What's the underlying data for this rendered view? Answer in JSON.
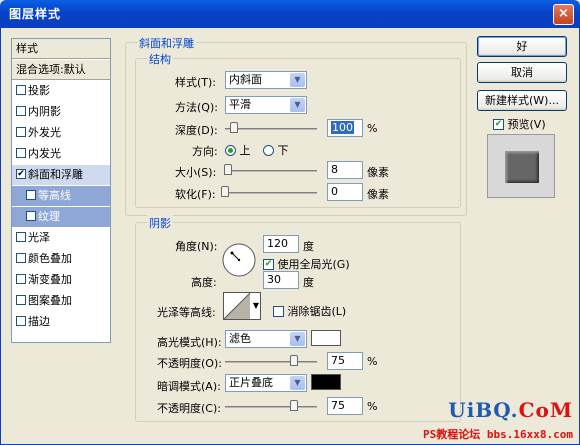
{
  "window": {
    "title": "图层样式",
    "close": "×"
  },
  "style_list": {
    "items": [
      {
        "label": "样式",
        "type": "head"
      },
      {
        "label": "混合选项:默认",
        "type": "head"
      },
      {
        "label": "投影",
        "checked": false
      },
      {
        "label": "内阴影",
        "checked": false
      },
      {
        "label": "外发光",
        "checked": false
      },
      {
        "label": "内发光",
        "checked": false
      },
      {
        "label": "斜面和浮雕",
        "checked": true
      },
      {
        "label": "等高线",
        "checked": false,
        "sub": true
      },
      {
        "label": "纹理",
        "checked": false,
        "sub": true
      },
      {
        "label": "光泽",
        "checked": false
      },
      {
        "label": "颜色叠加",
        "checked": false
      },
      {
        "label": "渐变叠加",
        "checked": false
      },
      {
        "label": "图案叠加",
        "checked": false
      },
      {
        "label": "描边",
        "checked": false
      }
    ]
  },
  "bevel": {
    "group_title": "斜面和浮雕",
    "structure_title": "结构",
    "style_label": "样式(T):",
    "style_value": "内斜面",
    "technique_label": "方法(Q):",
    "technique_value": "平滑",
    "depth_label": "深度(D):",
    "depth_value": "100",
    "depth_pct": 0.1,
    "direction_label": "方向:",
    "direction_up": "上",
    "direction_down": "下",
    "size_label": "大小(S):",
    "size_value": "8",
    "size_pct": 0.03,
    "soften_label": "软化(F):",
    "soften_value": "0",
    "soften_pct": 0.0,
    "percent": "%",
    "px": "像素"
  },
  "shading": {
    "title": "阴影",
    "angle_label": "角度(N):",
    "angle_value": "120",
    "degree": "度",
    "global_light": "使用全局光(G)",
    "global_light_checked": true,
    "altitude_label": "高度:",
    "altitude_value": "30",
    "gloss_label": "光泽等高线:",
    "anti_alias": "消除锯齿(L)",
    "highlight_mode_label": "高光模式(H):",
    "highlight_mode": "滤色",
    "highlight_color": "#ffffff",
    "highlight_opacity_label": "不透明度(O):",
    "highlight_opacity": "75",
    "highlight_opacity_pct": 0.75,
    "shadow_mode_label": "暗调模式(A):",
    "shadow_mode": "正片叠底",
    "shadow_color": "#000000",
    "shadow_opacity_label": "不透明度(C):",
    "shadow_opacity": "75",
    "shadow_opacity_pct": 0.75
  },
  "buttons": {
    "ok": "好",
    "cancel": "取消",
    "new_style": "新建样式(W)...",
    "preview": "预览(V)"
  },
  "watermark": {
    "line1_a": "UiBQ.",
    "line1_b": "CoM",
    "line2": "PS教程论坛 bbs.16xx8.com"
  }
}
